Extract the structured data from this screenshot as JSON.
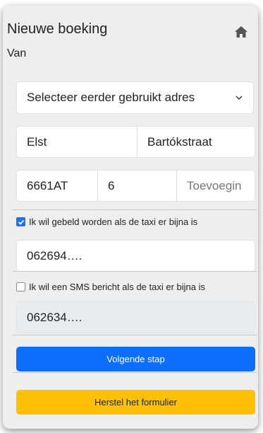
{
  "header": {
    "title": "Nieuwe boeking",
    "home_icon": "home-icon"
  },
  "section": {
    "label": "Van"
  },
  "address": {
    "select_label": "Selecteer eerder gebruikt adres",
    "city": "Elst",
    "street": "Bartókstraat",
    "postcode": "6661AT",
    "house_number": "6",
    "addition_placeholder": "Toevoegin"
  },
  "call_option": {
    "checked": true,
    "label": "Ik wil gebeld worden als de taxi er bijna is",
    "phone": "062694…."
  },
  "sms_option": {
    "checked": false,
    "label": "Ik wil een SMS bericht als de taxi er bijna is",
    "phone": "062634…."
  },
  "actions": {
    "next_label": "Volgende stap",
    "reset_label": "Herstel het formulier"
  },
  "colors": {
    "primary": "#0d6efd",
    "warning": "#ffc107",
    "panel": "#eeeeee",
    "checkbox": "#1a73e8"
  }
}
